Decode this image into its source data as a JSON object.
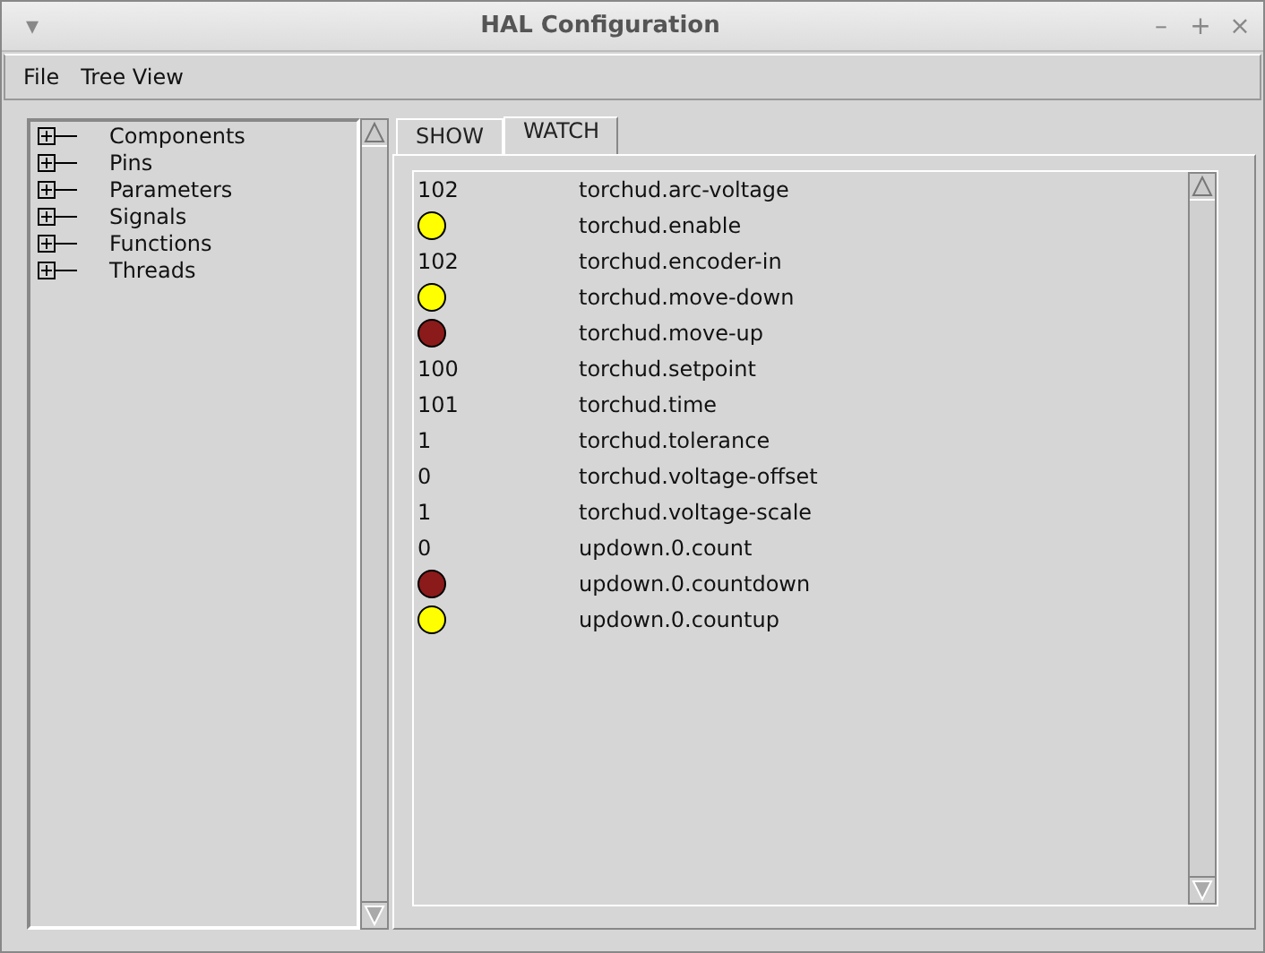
{
  "window": {
    "title": "HAL Configuration",
    "controls": [
      "▾",
      "–",
      "+",
      "×"
    ]
  },
  "menu": [
    "File",
    "Tree View"
  ],
  "tree": [
    {
      "label": "Components",
      "expanded": false
    },
    {
      "label": "Pins",
      "expanded": false
    },
    {
      "label": "Parameters",
      "expanded": false
    },
    {
      "label": "Signals",
      "expanded": false
    },
    {
      "label": "Functions",
      "expanded": false
    },
    {
      "label": "Threads",
      "expanded": false
    }
  ],
  "tabs": [
    {
      "label": "SHOW",
      "selected": false
    },
    {
      "label": "WATCH",
      "selected": true
    }
  ],
  "watch": [
    {
      "kind": "value",
      "value": "102",
      "name": "torchud.arc-voltage"
    },
    {
      "kind": "led",
      "on": true,
      "name": "torchud.enable"
    },
    {
      "kind": "value",
      "value": "102",
      "name": "torchud.encoder-in"
    },
    {
      "kind": "led",
      "on": true,
      "name": "torchud.move-down"
    },
    {
      "kind": "led",
      "on": false,
      "name": "torchud.move-up"
    },
    {
      "kind": "value",
      "value": "100",
      "name": "torchud.setpoint"
    },
    {
      "kind": "value",
      "value": "101",
      "name": "torchud.time"
    },
    {
      "kind": "value",
      "value": "1",
      "name": "torchud.tolerance"
    },
    {
      "kind": "value",
      "value": "0",
      "name": "torchud.voltage-offset"
    },
    {
      "kind": "value",
      "value": "1",
      "name": "torchud.voltage-scale"
    },
    {
      "kind": "value",
      "value": "0",
      "name": "updown.0.count"
    },
    {
      "kind": "led",
      "on": false,
      "name": "updown.0.countdown"
    },
    {
      "kind": "led",
      "on": true,
      "name": "updown.0.countup"
    }
  ]
}
